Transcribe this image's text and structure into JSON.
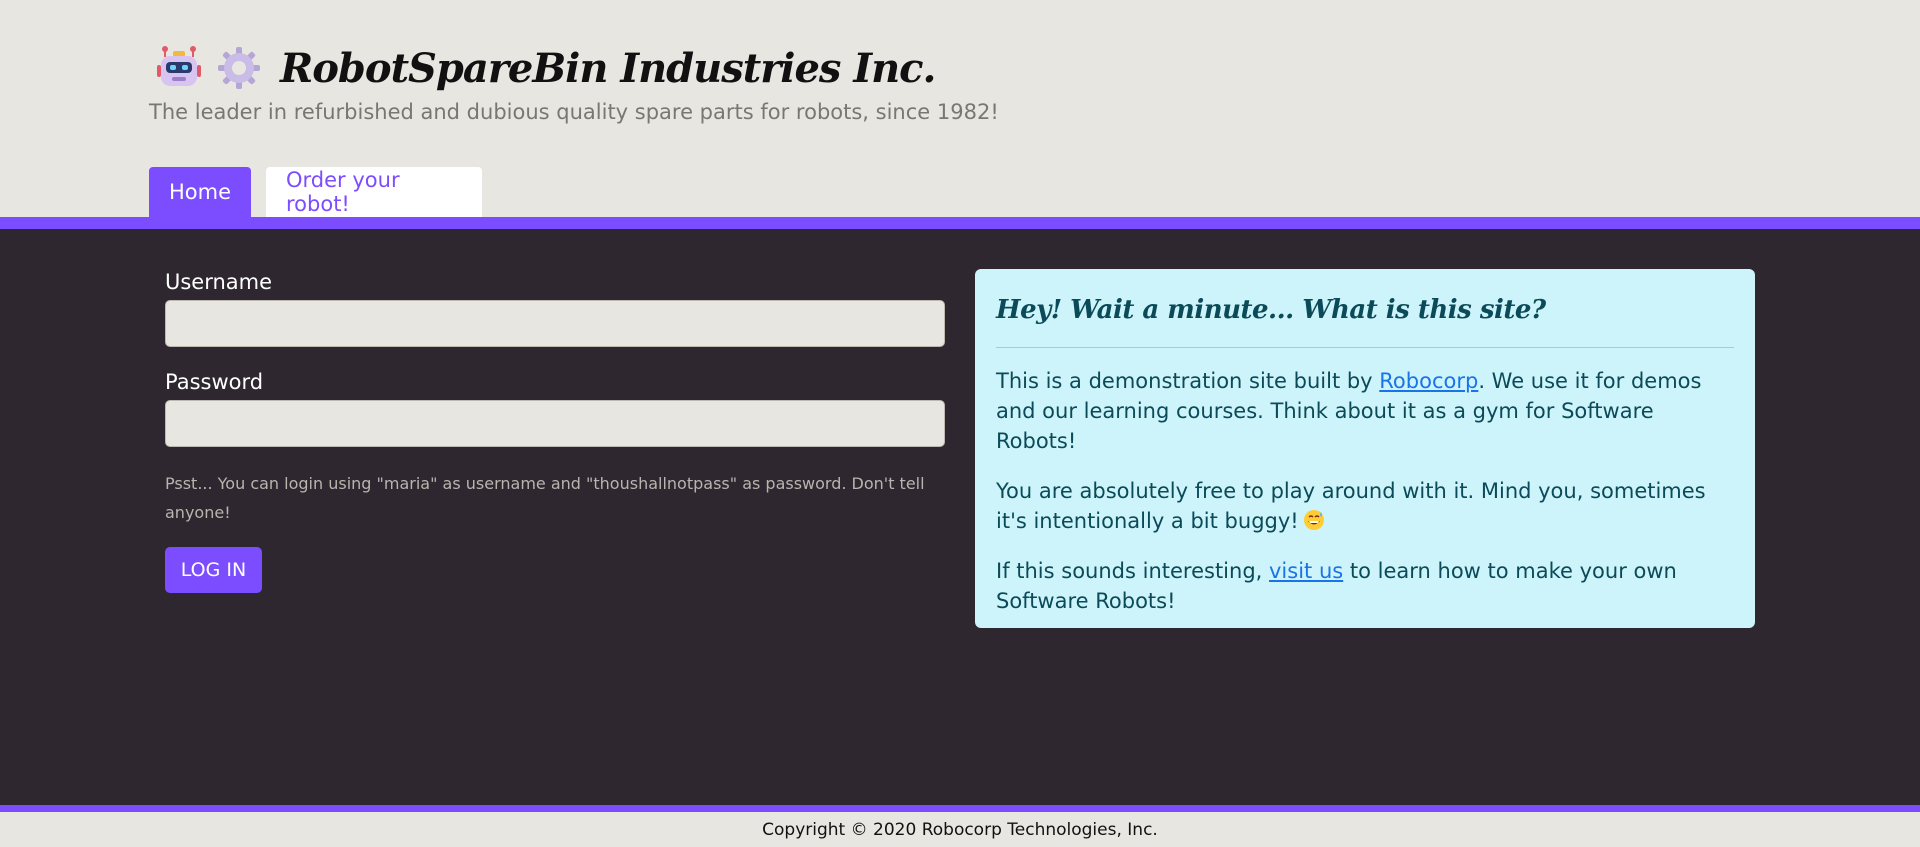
{
  "header": {
    "title": "RobotSpareBin Industries Inc.",
    "tagline": "The leader in refurbished and dubious quality spare parts for robots, since 1982!",
    "icons": [
      "robot-icon",
      "gear-icon"
    ]
  },
  "tabs": [
    {
      "label": "Home",
      "active": true
    },
    {
      "label": "Order your robot!",
      "active": false
    }
  ],
  "login_form": {
    "username_label": "Username",
    "username_value": "",
    "password_label": "Password",
    "password_value": "",
    "hint": "Psst... You can login using \"maria\" as username and \"thoushallnotpass\" as password. Don't tell anyone!",
    "login_button": "LOG IN"
  },
  "info_card": {
    "title": "Hey! Wait a minute... What is this site?",
    "p1_before": "This is a demonstration site built by ",
    "p1_link": "Robocorp",
    "p1_after": ". We use it for demos and our learning courses. Think about it as a gym for Software Robots!",
    "p2": "You are absolutely free to play around with it. Mind you, sometimes it's intentionally a bit buggy!",
    "p2_emoji": "grinning-sweat-icon",
    "p3_before": "If this sounds interesting, ",
    "p3_link": "visit us",
    "p3_after": " to learn how to make your own Software Robots!"
  },
  "footer": {
    "copyright": "Copyright © 2020 Robocorp Technologies, Inc."
  },
  "colors": {
    "accent": "#7c4dff",
    "main_bg": "#2e272f",
    "card_bg": "#cdf4fa",
    "card_text": "#0b4a58",
    "page_bg": "#e8e6e1",
    "link": "#1a73e8"
  }
}
